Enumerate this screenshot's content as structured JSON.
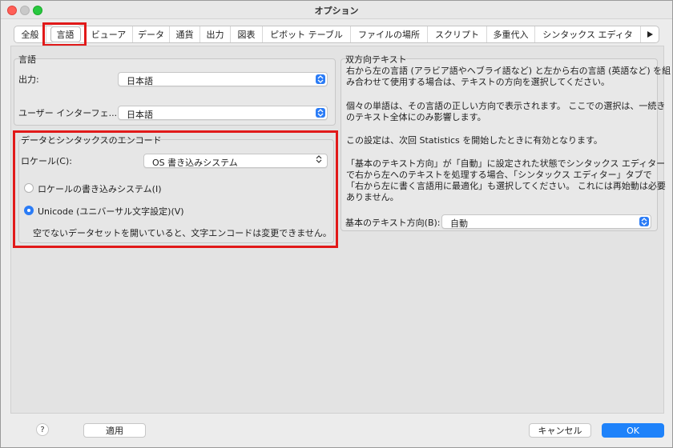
{
  "window": {
    "title": "オプション"
  },
  "tabs": [
    {
      "label": "全般"
    },
    {
      "label": "言語",
      "selected": true
    },
    {
      "label": "ビューア"
    },
    {
      "label": "データ"
    },
    {
      "label": "通貨"
    },
    {
      "label": "出力"
    },
    {
      "label": "図表"
    },
    {
      "label": "ピボット テーブル"
    },
    {
      "label": "ファイルの場所"
    },
    {
      "label": "スクリプト"
    },
    {
      "label": "多重代入"
    },
    {
      "label": "シンタックス エディタ"
    }
  ],
  "tabs_more_icon": "triangle-right-icon",
  "language_group": {
    "title": "言語",
    "output_label": "出力:",
    "output_value": "日本語",
    "ui_label": "ユーザー インターフェ...",
    "ui_value": "日本語"
  },
  "encoding_group": {
    "title": "データとシンタックスのエンコード",
    "locale_label": "ロケール(C):",
    "locale_value": "OS 書き込みシステム",
    "radio_locale_label": "ロケールの書き込みシステム(I)",
    "radio_locale_selected": false,
    "radio_unicode_label": "Unicode (ユニバーサル文字設定)(V)",
    "radio_unicode_selected": true,
    "note": "空でないデータセットを開いていると、文字エンコードは変更できません。"
  },
  "bidi_group": {
    "title": "双方向テキスト",
    "para1_line1": "右から左の言語 (アラビア語やヘブライ語など) と左から右の言語 (英語など) を組",
    "para1_line2": "み合わせて使用する場合は、テキストの方向を選択してください。",
    "para2_line1": "個々の単語は、その言語の正しい方向で表示されます。 ここでの選択は、一続き",
    "para2_line2": "のテキスト全体にのみ影響します。",
    "para3": "この設定は、次回 Statistics を開始したときに有効となります。",
    "para4_line1": "「基本のテキスト方向」が「自動」に設定された状態でシンタックス エディター",
    "para4_line2": "で右から左へのテキストを処理する場合、「シンタックス エディター」タブで",
    "para4_line3": "「右から左に書く言語用に最適化」も選択してください。 これには再始動は必要",
    "para4_line4": "ありません。",
    "direction_label": "基本のテキスト方向(B):",
    "direction_value": "自動"
  },
  "footer": {
    "help_label": "?",
    "apply_label": "適用",
    "cancel_label": "キャンセル",
    "ok_label": "OK"
  },
  "colors": {
    "accent": "#2b7cf6",
    "highlight": "#e11919"
  }
}
